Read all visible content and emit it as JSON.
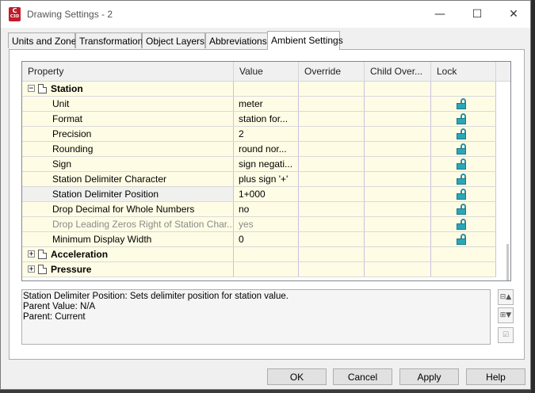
{
  "window": {
    "title": "Drawing Settings - 2",
    "app_icon_letter": "C",
    "app_icon_small": "C3D"
  },
  "title_buttons": {
    "minimize": "—",
    "maximize": "☐",
    "close": "✕"
  },
  "tabs": [
    {
      "label": "Units and Zone",
      "active": false
    },
    {
      "label": "Transformation",
      "active": false
    },
    {
      "label": "Object Layers",
      "active": false
    },
    {
      "label": "Abbreviations",
      "active": false
    },
    {
      "label": "Ambient Settings",
      "active": true
    }
  ],
  "grid": {
    "columns": [
      "Property",
      "Value",
      "Override",
      "Child Over...",
      "Lock"
    ],
    "rows": [
      {
        "type": "group",
        "expanded": true,
        "label": "Station",
        "expander": "−"
      },
      {
        "label": "Unit",
        "value": "meter",
        "lock": true
      },
      {
        "label": "Format",
        "value": "station for...",
        "lock": true
      },
      {
        "label": "Precision",
        "value": "2",
        "lock": true
      },
      {
        "label": "Rounding",
        "value": "round nor...",
        "lock": true
      },
      {
        "label": "Sign",
        "value": "sign negati...",
        "lock": true
      },
      {
        "label": "Station Delimiter Character",
        "value": "plus sign '+'",
        "lock": true
      },
      {
        "label": "Station Delimiter Position",
        "value": "1+000",
        "lock": true,
        "selected": true
      },
      {
        "label": "Drop Decimal for Whole Numbers",
        "value": "no",
        "lock": true
      },
      {
        "label": "Drop Leading Zeros Right of Station Char...",
        "value": "yes",
        "lock": true,
        "disabled": true
      },
      {
        "label": "Minimum Display Width",
        "value": "0",
        "lock": true
      },
      {
        "type": "group",
        "expanded": false,
        "label": "Acceleration",
        "expander": "+"
      },
      {
        "type": "group",
        "expanded": false,
        "label": "Pressure",
        "expander": "+"
      }
    ]
  },
  "description": {
    "line1": "Station Delimiter Position: Sets delimiter position for station value.",
    "line2": "Parent Value: N/A",
    "line3": "Parent: Current"
  },
  "side_icons": [
    "collapse-all-icon",
    "expand-all-icon",
    "checkbox-icon"
  ],
  "buttons": {
    "ok": "OK",
    "cancel": "Cancel",
    "apply": "Apply",
    "help": "Help"
  },
  "colors": {
    "row_bg": "#fffce5",
    "lock": "#2aa6b9",
    "app_icon": "#c11d2b"
  }
}
